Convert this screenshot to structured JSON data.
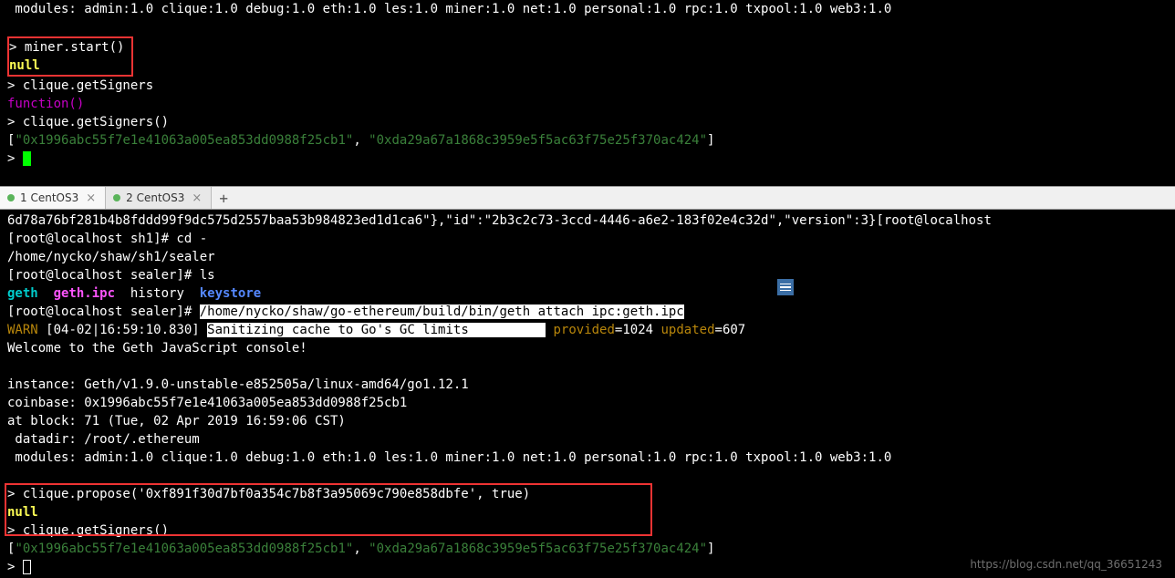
{
  "top": {
    "modules_line": " modules: admin:1.0 clique:1.0 debug:1.0 eth:1.0 les:1.0 miner:1.0 net:1.0 personal:1.0 rpc:1.0 txpool:1.0 web3:1.0",
    "miner_cmd": "> miner.start()",
    "null1": "null",
    "cmd2": "> clique.getSigners",
    "func": "function()",
    "cmd3": "> clique.getSigners()",
    "arr_open": "[",
    "arr_a": "\"0x1996abc55f7e1e41063a005ea853dd0988f25cb1\"",
    "arr_sep": ", ",
    "arr_b": "\"0xda29a67a1868c3959e5f5ac63f75e25f370ac424\"",
    "arr_close": "]",
    "prompt_only": "> "
  },
  "tabs": {
    "t1": "1 CentOS3",
    "t2": "2 CentOS3",
    "close": "×",
    "add": "+"
  },
  "bottom": {
    "l1": "6d78a76bf281b4b8fddd99f9dc575d2557baa53b984823ed1d1ca6\"},\"id\":\"2b3c2c73-3ccd-4446-a6e2-183f02e4c32d\",\"version\":3}[root@localhost",
    "l2": "[root@localhost sh1]# cd -",
    "l3": "/home/nycko/shaw/sh1/sealer",
    "l4": "[root@localhost sealer]# ls",
    "ls_geth": "geth",
    "ls_ipc": "geth.ipc",
    "ls_history": "history",
    "ls_keystore": "keystore",
    "l6a": "[root@localhost sealer]# ",
    "l6b": "/home/nycko/shaw/go-ethereum/build/bin/geth attach ipc:geth.ipc",
    "l7_warn": "WARN ",
    "l7_ts": "[04-02|16:59:10.830] ",
    "l7_msg": "Sanitizing cache to Go's GC limits          ",
    "l7_p": "provided",
    "l7_pv": "=1024 ",
    "l7_u": "updated",
    "l7_uv": "=607",
    "l8": "Welcome to the Geth JavaScript console!",
    "l10": "instance: Geth/v1.9.0-unstable-e852505a/linux-amd64/go1.12.1",
    "l11": "coinbase: 0x1996abc55f7e1e41063a005ea853dd0988f25cb1",
    "l12": "at block: 71 (Tue, 02 Apr 2019 16:59:06 CST)",
    "l13": " datadir: /root/.ethereum",
    "l14": " modules: admin:1.0 clique:1.0 debug:1.0 eth:1.0 les:1.0 miner:1.0 net:1.0 personal:1.0 rpc:1.0 txpool:1.0 web3:1.0",
    "cmd_propose": "> clique.propose('0xf891f30d7bf0a354c7b8f3a95069c790e858dbfe', true)",
    "null2": "null",
    "cmd_signers": "> clique.getSigners()",
    "arr2_open": "[",
    "arr2_a": "\"0x1996abc55f7e1e41063a005ea853dd0988f25cb1\"",
    "arr2_sep": ", ",
    "arr2_b": "\"0xda29a67a1868c3959e5f5ac63f75e25f370ac424\"",
    "arr2_close": "]",
    "prompt_only": "> "
  },
  "watermark": "https://blog.csdn.net/qq_36651243"
}
